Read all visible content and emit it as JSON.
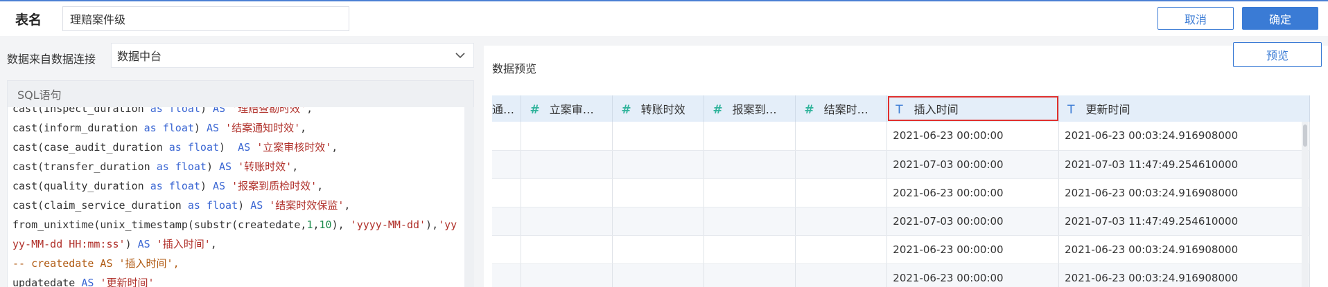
{
  "header": {
    "table_name_label": "表名",
    "table_name_value": "理赔案件级",
    "cancel_label": "取消",
    "confirm_label": "确定"
  },
  "source": {
    "label": "数据来自数据连接",
    "selected": "数据中台"
  },
  "sql": {
    "title": "SQL语句"
  },
  "preview": {
    "title": "数据预览",
    "button_label": "预览",
    "columns": [
      {
        "name": "通…",
        "type_icon": "hash-icon"
      },
      {
        "name": "立案审…",
        "type_icon": "hash-icon"
      },
      {
        "name": "转账时效",
        "type_icon": "hash-icon"
      },
      {
        "name": "报案到…",
        "type_icon": "hash-icon"
      },
      {
        "name": "结案时…",
        "type_icon": "hash-icon"
      },
      {
        "name": "插入时间",
        "type_icon": "text-type-icon"
      },
      {
        "name": "更新时间",
        "type_icon": "text-type-icon"
      }
    ],
    "rows": [
      [
        "",
        "",
        "",
        "",
        "",
        "2021-06-23 00:00:00",
        "2021-06-23 00:03:24.916908000"
      ],
      [
        "",
        "",
        "",
        "",
        "",
        "2021-07-03 00:00:00",
        "2021-07-03 11:47:49.254610000"
      ],
      [
        "",
        "",
        "",
        "",
        "",
        "2021-06-23 00:00:00",
        "2021-06-23 00:03:24.916908000"
      ],
      [
        "",
        "",
        "",
        "",
        "",
        "2021-07-03 00:00:00",
        "2021-07-03 11:47:49.254610000"
      ],
      [
        "",
        "",
        "",
        "",
        "",
        "2021-06-23 00:00:00",
        "2021-06-23 00:03:24.916908000"
      ],
      [
        "",
        "",
        "",
        "",
        "",
        "2021-06-23 00:00:00",
        "2021-06-23 00:03:24.916908000"
      ]
    ]
  },
  "colors": {
    "accent": "#3a7bd5",
    "highlight": "#e0302e",
    "numeric_icon": "#2fb39b"
  }
}
